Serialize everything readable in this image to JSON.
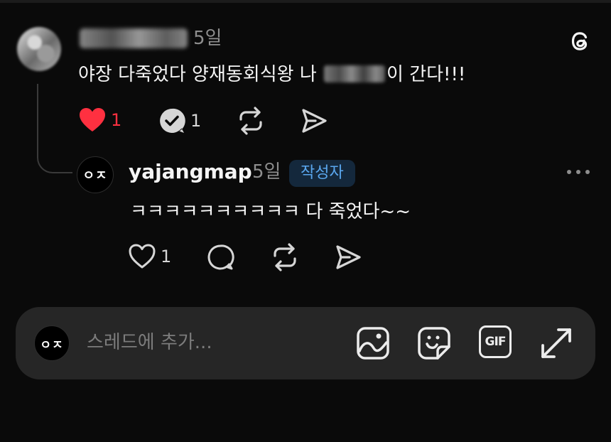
{
  "post": {
    "username": "",
    "time": "5일",
    "content_before": "야장 다죽었다 양재동회식왕 나 ",
    "content_after": "이 간다!!!",
    "like_count": "1",
    "comment_count": "1"
  },
  "reply": {
    "avatar_text": "ㅇㅈ",
    "username": "yajangmap",
    "time": "5일",
    "author_badge": "작성자",
    "content": "ㅋㅋㅋㅋㅋㅋㅋㅋㅋㅋ 다 죽었다~~",
    "like_count": "1"
  },
  "composer": {
    "avatar_text": "ㅇㅈ",
    "placeholder": "스레드에 추가...",
    "gif_label": "GIF"
  },
  "colors": {
    "background": "#0a0a0a",
    "like_red": "#ff3040",
    "badge_bg": "#14283c",
    "badge_text": "#5aa7ef",
    "composer_bg": "#262626"
  },
  "icons": [
    "threads-logo-icon",
    "heart-icon",
    "reply-check-icon",
    "repost-icon",
    "share-icon",
    "more-icon",
    "comment-icon",
    "image-icon",
    "sticker-icon",
    "gif-icon",
    "expand-icon"
  ]
}
